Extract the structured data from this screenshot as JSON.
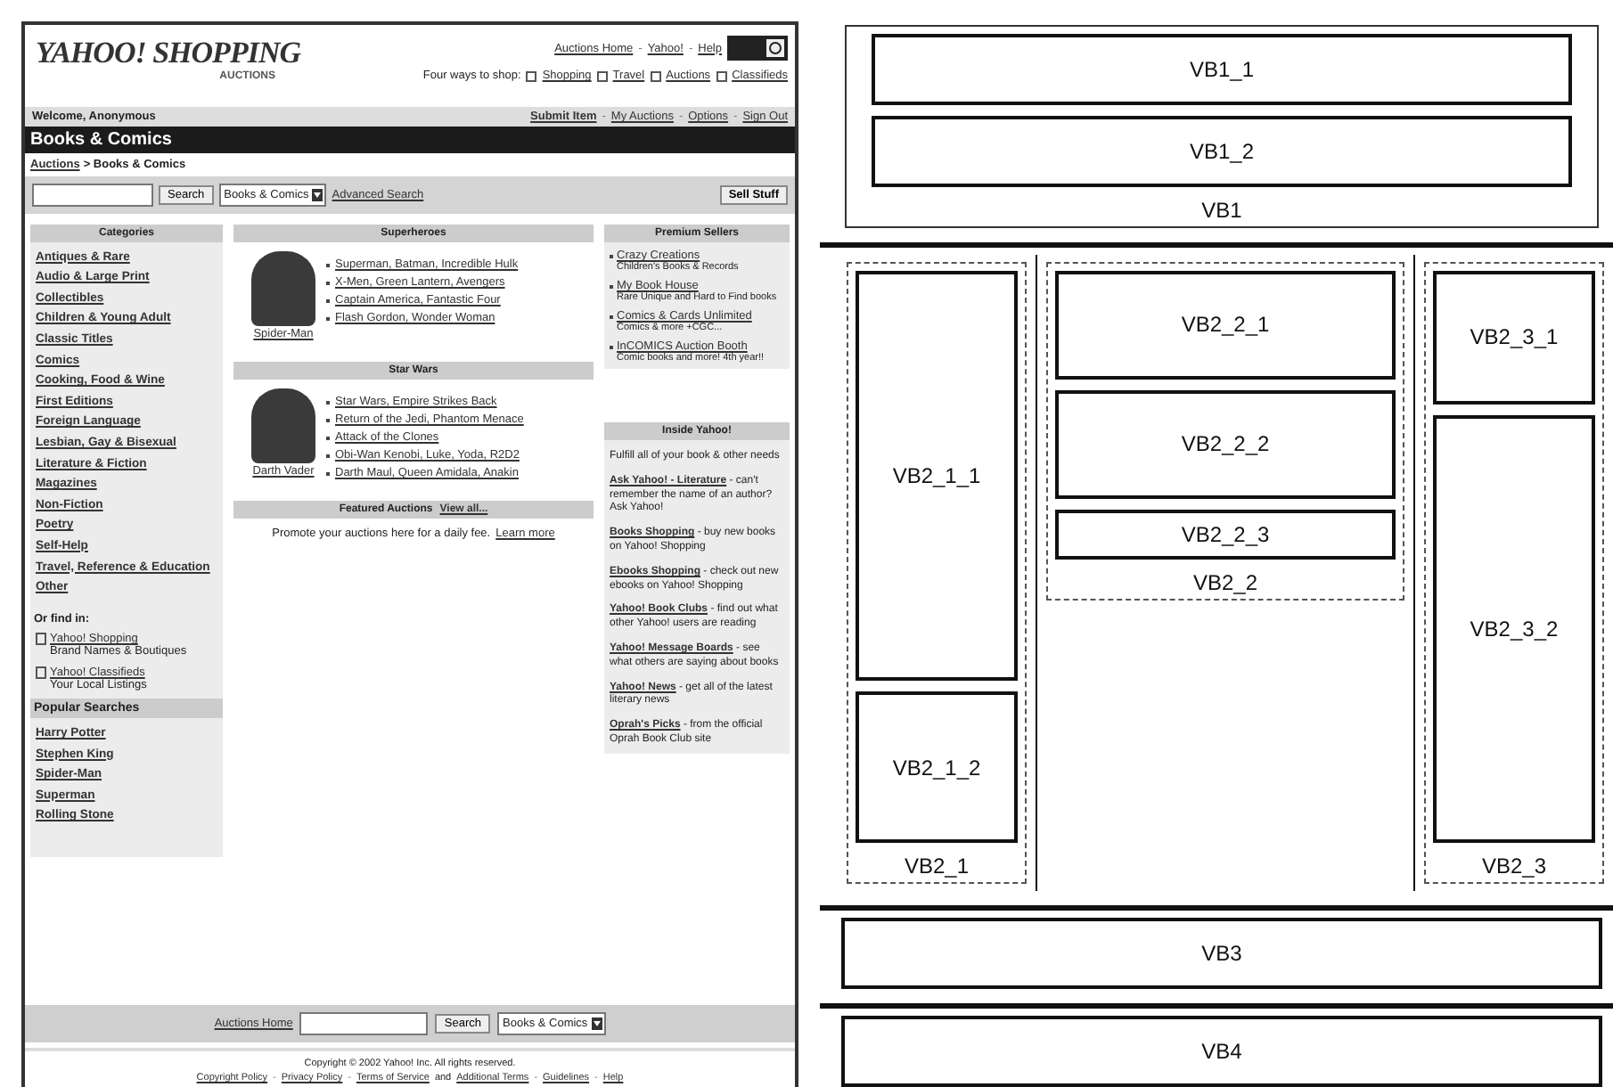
{
  "site": {
    "separator": "-",
    "logo": "YAHOO! SHOPPING",
    "logo_sub": "AUCTIONS",
    "top_links": [
      "Auctions Home",
      "Yahoo!",
      "Help"
    ],
    "ways_label": "Four ways to shop:",
    "ways": [
      "Shopping",
      "Travel",
      "Auctions",
      "Classifieds"
    ],
    "welcome": "Welcome, Anonymous",
    "user_links": [
      "Submit Item",
      "My Auctions",
      "Options",
      "Sign Out"
    ],
    "title": "Books & Comics",
    "breadcrumb": {
      "link": "Auctions",
      "rest": "> Books & Comics"
    },
    "search": {
      "button": "Search",
      "select": "Books & Comics",
      "advanced": "Advanced Search",
      "sell": "Sell Stuff"
    }
  },
  "categories": {
    "heading": "Categories",
    "items": [
      "Antiques & Rare",
      "Audio & Large Print",
      "Collectibles",
      "Children & Young Adult",
      "Classic Titles",
      "Comics",
      "Cooking, Food & Wine",
      "First Editions",
      "Foreign Language",
      "Lesbian, Gay & Bisexual",
      "Literature & Fiction",
      "Magazines",
      "Non-Fiction",
      "Poetry",
      "Self-Help",
      "Travel, Reference & Education",
      "Other"
    ],
    "find_heading": "Or find in:",
    "find": [
      {
        "link": "Yahoo! Shopping",
        "desc": "Brand Names & Boutiques"
      },
      {
        "link": "Yahoo! Classifieds",
        "desc": "Your Local Listings"
      }
    ],
    "popular_heading": "Popular Searches",
    "popular": [
      "Harry Potter",
      "Stephen King",
      "Spider-Man",
      "Superman",
      "Rolling Stone"
    ]
  },
  "features": [
    {
      "heading": "Superheroes",
      "caption": "Spider-Man",
      "links": [
        "Superman, Batman, Incredible Hulk",
        "X-Men, Green Lantern, Avengers",
        "Captain America, Fantastic Four",
        "Flash Gordon, Wonder Woman"
      ]
    },
    {
      "heading": "Star Wars",
      "caption": "Darth Vader",
      "links": [
        "Star Wars, Empire Strikes Back",
        "Return of the Jedi, Phantom Menace",
        "Attack of the Clones",
        "Obi-Wan Kenobi, Luke, Yoda, R2D2",
        "Darth Maul, Queen Amidala, Anakin"
      ]
    }
  ],
  "featured": {
    "heading": "Featured Auctions",
    "view_all": "View all...",
    "text": "Promote your auctions here for a daily fee.",
    "learn": "Learn more"
  },
  "premium": {
    "heading": "Premium Sellers",
    "items": [
      {
        "link": "Crazy Creations",
        "desc": "Children's Books & Records"
      },
      {
        "link": "My Book House",
        "desc": "Rare Unique and Hard to Find books"
      },
      {
        "link": "Comics & Cards Unlimited",
        "desc": "Comics & more +CGC..."
      },
      {
        "link": "InCOMICS Auction Booth",
        "desc": "Comic books and more! 4th year!!"
      }
    ]
  },
  "inside": {
    "heading": "Inside Yahoo!",
    "intro": "Fulfill all of your book & other needs",
    "items": [
      {
        "link": "Ask Yahoo! - Literature",
        "desc": "- can't remember the name of an author? Ask Yahoo!"
      },
      {
        "link": "Books Shopping",
        "desc": "- buy new books on Yahoo! Shopping"
      },
      {
        "link": "Ebooks Shopping",
        "desc": "- check out new ebooks on Yahoo! Shopping"
      },
      {
        "link": "Yahoo! Book Clubs",
        "desc": "- find out what other Yahoo! users are reading"
      },
      {
        "link": "Yahoo! Message Boards",
        "desc": "- see what others are saying about books"
      },
      {
        "link": "Yahoo! News",
        "desc": "- get all of the latest literary news"
      },
      {
        "link": "Oprah's Picks",
        "desc": "- from the official Oprah Book Club site"
      }
    ]
  },
  "footer": {
    "separator": "-",
    "home": "Auctions Home",
    "button": "Search",
    "select": "Books & Comics",
    "copyright": "Copyright © 2002 Yahoo! Inc. All rights reserved.",
    "links": [
      "Copyright Policy",
      "Privacy Policy",
      "Terms of Service",
      "Additional Terms",
      "Guidelines",
      "Help"
    ],
    "and": "and"
  },
  "diagram": [
    {
      "label": "VB1",
      "kind": "stack",
      "children": [
        {
          "label": "VB1_1"
        },
        {
          "label": "VB1_2"
        }
      ]
    },
    {
      "kind": "columns",
      "children": [
        {
          "label": "VB2_1",
          "children": [
            {
              "label": "VB2_1_1"
            },
            {
              "label": "VB2_1_2"
            }
          ]
        },
        {
          "label": "VB2_2",
          "children": [
            {
              "label": "VB2_2_1"
            },
            {
              "label": "VB2_2_2"
            },
            {
              "label": "VB2_2_3"
            }
          ]
        },
        {
          "label": "VB2_3",
          "children": [
            {
              "label": "VB2_3_1"
            },
            {
              "label": "VB2_3_2"
            }
          ]
        }
      ]
    },
    {
      "label": "VB3",
      "kind": "leaf"
    },
    {
      "label": "VB4",
      "kind": "leaf"
    }
  ]
}
